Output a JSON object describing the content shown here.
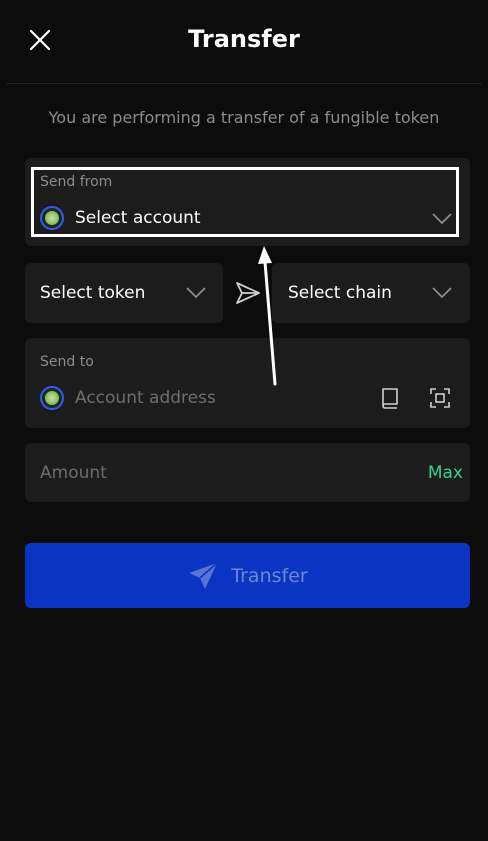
{
  "header": {
    "title": "Transfer",
    "close_icon": "close-icon"
  },
  "subtitle": "You are performing a transfer of a fungible token",
  "send_from": {
    "label": "Send from",
    "value": "Select account"
  },
  "token_select": {
    "value": "Select token"
  },
  "chain_select": {
    "value": "Select chain"
  },
  "send_to": {
    "label": "Send to",
    "placeholder": "Account address",
    "address_book_icon": "book-icon",
    "scan_icon": "scan-icon"
  },
  "amount": {
    "placeholder": "Amount",
    "max_label": "Max"
  },
  "transfer_button": {
    "label": "Transfer",
    "icon": "send-icon"
  },
  "colors": {
    "background": "#0c0c0c",
    "card": "#1c1c1c",
    "accent_button": "#0a34c2",
    "max_link": "#3ecf8e",
    "muted_text": "#8c8c8c"
  }
}
